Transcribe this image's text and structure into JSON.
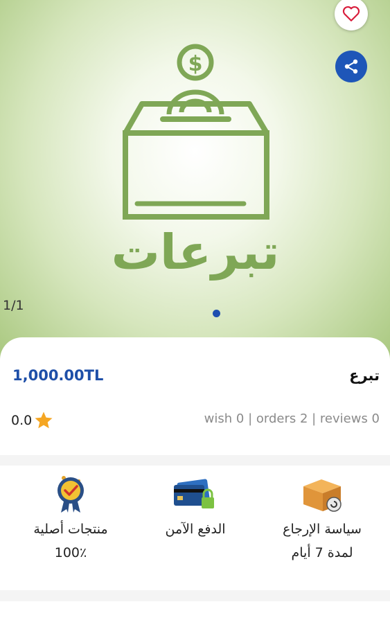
{
  "hero": {
    "image_caption": "تبرعات",
    "image_counter": "1/1",
    "favorite_icon": "heart-outline-icon",
    "share_icon": "share-icon",
    "accent": "#1e56b8",
    "illustration_color": "#7fa756"
  },
  "product": {
    "title": "تبرع",
    "price": "1,000.00TL",
    "rating": "0.0",
    "stats": "wish 0 | orders 2 | reviews 0"
  },
  "features": [
    {
      "icon": "return-box-icon",
      "line1": "سياسة الإرجاع",
      "line2": "لمدة 7 أيام"
    },
    {
      "icon": "secure-card-icon",
      "line1": "الدفع الآمن",
      "line2": ""
    },
    {
      "icon": "quality-badge-icon",
      "line1": "منتجات أصلية",
      "line2": "100٪"
    }
  ]
}
